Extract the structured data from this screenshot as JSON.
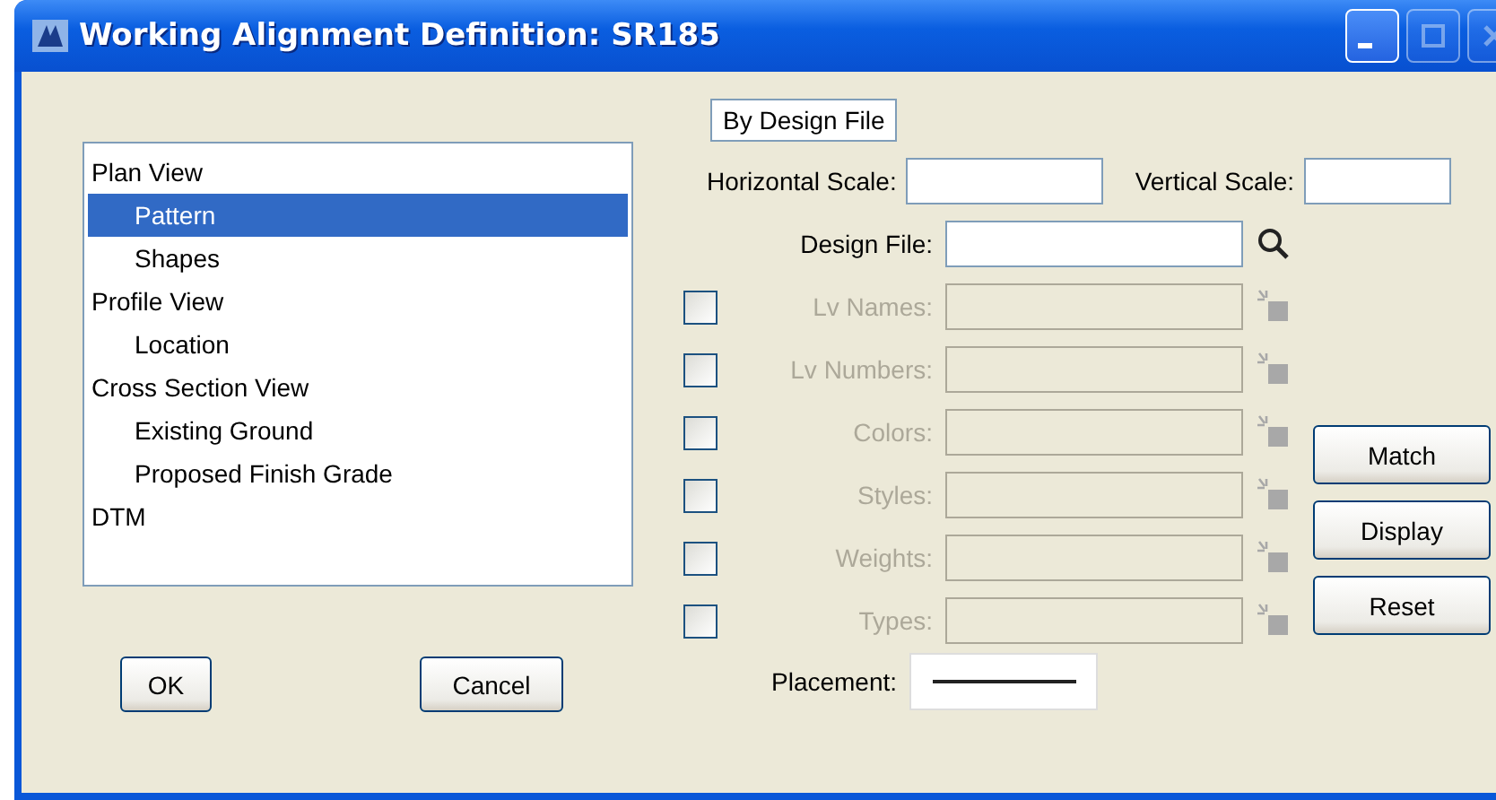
{
  "window": {
    "title": "Working Alignment Definition: SR185"
  },
  "tree": [
    {
      "label": "Plan View",
      "selected": false,
      "children": [
        {
          "label": "Pattern",
          "selected": true
        },
        {
          "label": "Shapes",
          "selected": false
        }
      ]
    },
    {
      "label": "Profile View",
      "selected": false,
      "children": [
        {
          "label": "Location",
          "selected": false
        }
      ]
    },
    {
      "label": "Cross Section View",
      "selected": false,
      "children": [
        {
          "label": "Existing Ground",
          "selected": false
        },
        {
          "label": "Proposed Finish Grade",
          "selected": false
        }
      ]
    },
    {
      "label": "DTM",
      "selected": false
    }
  ],
  "dialog_buttons": [
    "OK",
    "Cancel"
  ],
  "mode_button": "By Design File",
  "horizontal_scale": {
    "label": "Horizontal Scale:"
  },
  "vertical_scale": {
    "label": "Vertical Scale:"
  },
  "design_file": {
    "label": "Design File:"
  },
  "filters": [
    {
      "label": "Lv Names:",
      "checked": false,
      "disabled": true
    },
    {
      "label": "Lv Numbers:",
      "checked": false,
      "disabled": true
    },
    {
      "label": "Colors:",
      "checked": false,
      "disabled": true
    },
    {
      "label": "Styles:",
      "checked": false,
      "disabled": true
    },
    {
      "label": "Weights:",
      "checked": false,
      "disabled": true
    },
    {
      "label": "Types:",
      "checked": false,
      "disabled": true
    }
  ],
  "side_buttons": [
    "Match",
    "Display",
    "Reset"
  ],
  "placement": {
    "label": "Placement:"
  }
}
